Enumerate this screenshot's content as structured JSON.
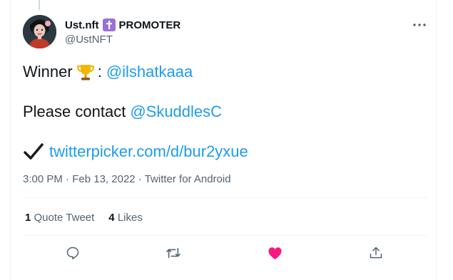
{
  "author": {
    "display_name": "Ust.nft",
    "badge_label": "PROMOTER",
    "handle": "@UstNFT"
  },
  "tweet": {
    "line1_prefix": "Winner",
    "line1_colon": ":",
    "line1_mention": "@ilshatkaaa",
    "line2_prefix": "Please contact",
    "line2_mention": "@SkuddlesC",
    "line3_link": "twitterpicker.com/d/bur2yxue"
  },
  "meta": {
    "time": "3:00 PM",
    "sep1": " · ",
    "date": "Feb 13, 2022",
    "sep2": " · ",
    "source": "Twitter for Android"
  },
  "stats": {
    "quote_count": "1",
    "quote_label": "Quote Tweet",
    "likes_count": "4",
    "likes_label": "Likes"
  },
  "colors": {
    "link": "#1d9bf0",
    "secondary_text": "#536471",
    "like_active": "#f91880",
    "badge": "#9b6fd3"
  },
  "icons": [
    "more-icon",
    "trophy-icon",
    "check-icon",
    "reply-icon",
    "retweet-icon",
    "like-icon",
    "share-icon",
    "cross-icon"
  ]
}
